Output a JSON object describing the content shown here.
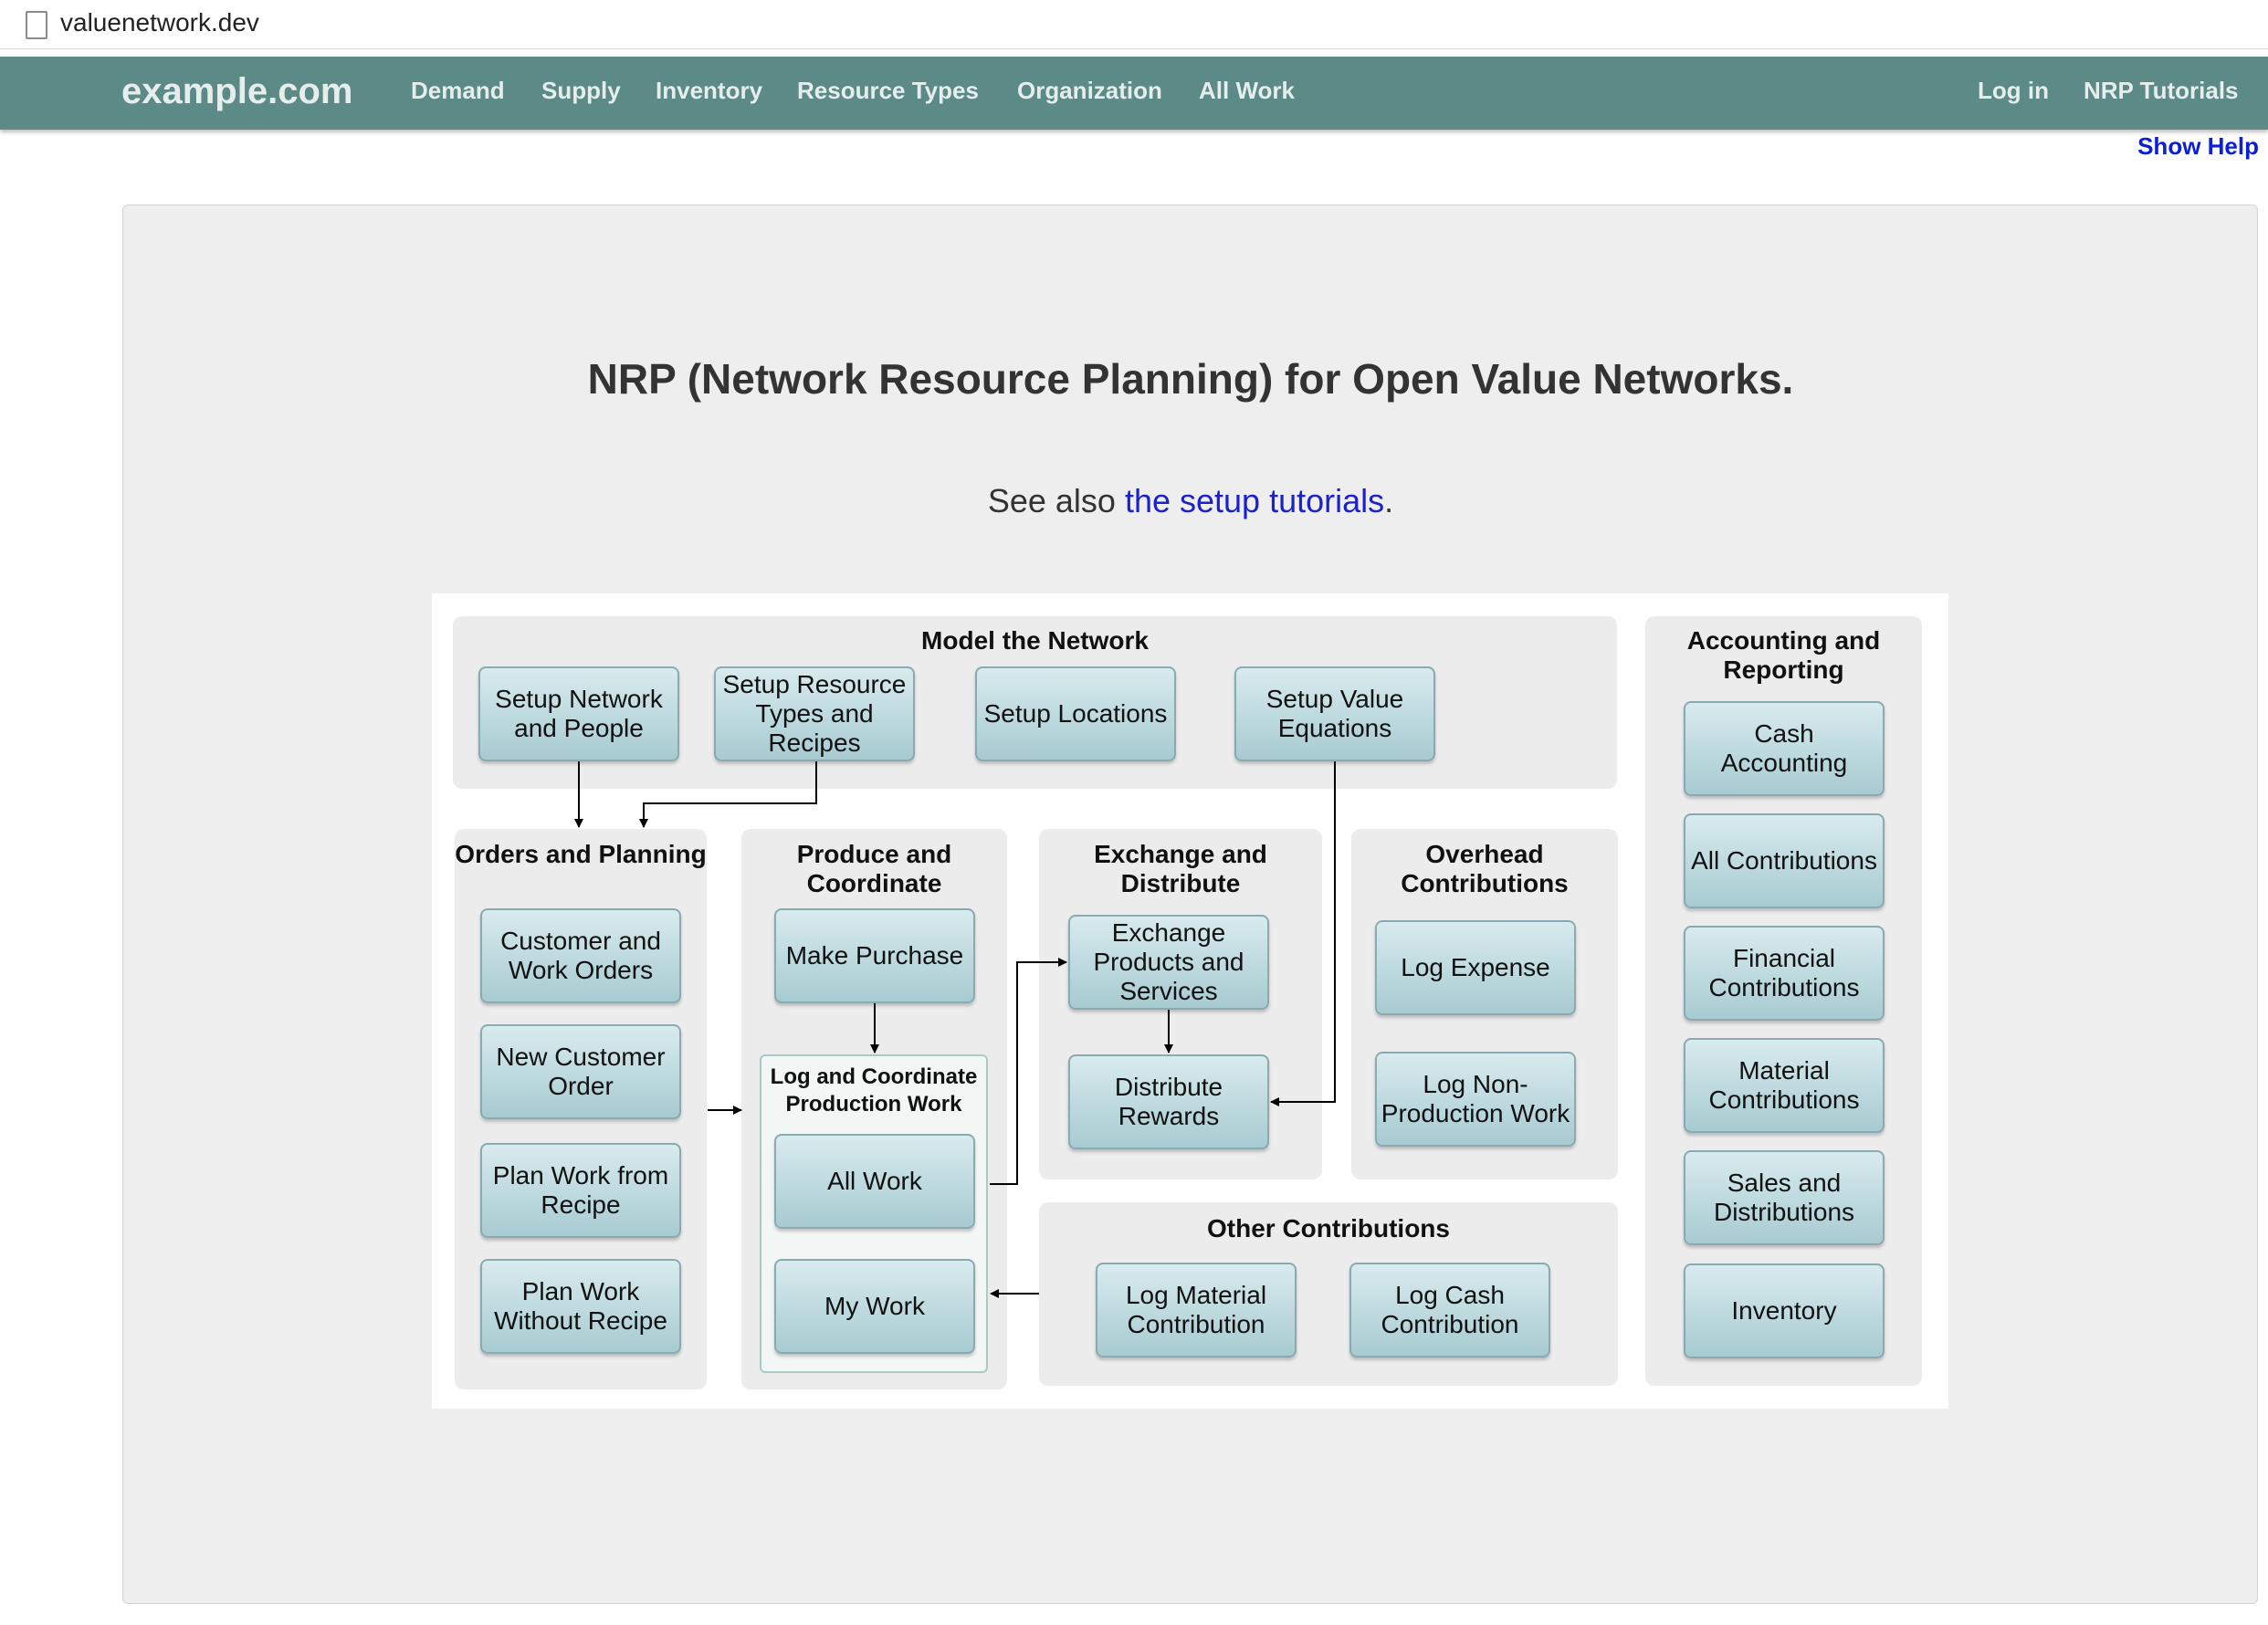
{
  "browser": {
    "url": "valuenetwork.dev"
  },
  "navbar": {
    "brand": "example.com",
    "items": [
      "Demand",
      "Supply",
      "Inventory",
      "Resource Types",
      "Organization",
      "All Work"
    ],
    "right_items": [
      "Log in",
      "NRP Tutorials"
    ],
    "bg_color": "#5b8a87"
  },
  "show_help": "Show Help",
  "main": {
    "title": "NRP (Network Resource Planning) for Open Value Networks.",
    "see_also_prefix": "See also ",
    "see_also_link": "the setup tutorials",
    "see_also_suffix": "."
  },
  "diagram": {
    "model": {
      "label": "Model the Network",
      "boxes": [
        "Setup Network and People",
        "Setup Resource Types and Recipes",
        "Setup Locations",
        "Setup Value Equations"
      ]
    },
    "orders": {
      "label": "Orders and Planning",
      "boxes": [
        "Customer and Work Orders",
        "New Customer Order",
        "Plan Work from Recipe",
        "Plan Work Without Recipe"
      ]
    },
    "produce": {
      "label": "Produce and Coordinate",
      "boxes": [
        "Make Purchase"
      ],
      "sub_label": "Log and Coordinate Production Work",
      "sub_boxes": [
        "All Work",
        "My Work"
      ]
    },
    "exchange": {
      "label": "Exchange and Distribute",
      "boxes": [
        "Exchange Products and Services",
        "Distribute Rewards"
      ]
    },
    "overhead": {
      "label": "Overhead Contributions",
      "boxes": [
        "Log Expense",
        "Log Non-Production Work"
      ]
    },
    "other": {
      "label": "Other Contributions",
      "boxes": [
        "Log Material Contribution",
        "Log Cash Contribution"
      ]
    },
    "accounting": {
      "label": "Accounting and Reporting",
      "boxes": [
        "Cash Accounting",
        "All Contributions",
        "Financial Contributions",
        "Material Contributions",
        "Sales and Distributions",
        "Inventory"
      ]
    }
  }
}
